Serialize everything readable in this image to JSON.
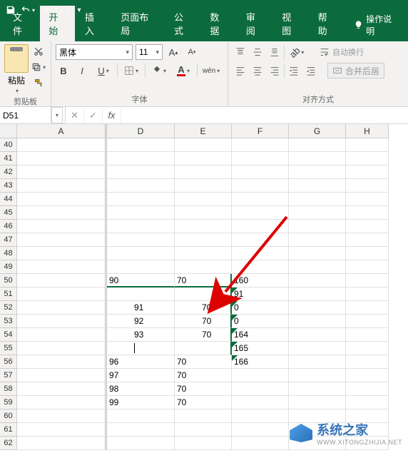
{
  "qat": {
    "save": "save-icon",
    "undo": "undo-icon",
    "redo": "redo-icon",
    "new": "new-icon",
    "print": "print-icon"
  },
  "tabs": {
    "file": "文件",
    "home": "开始",
    "insert": "插入",
    "pagelayout": "页面布局",
    "formulas": "公式",
    "data": "数据",
    "review": "审阅",
    "view": "视图",
    "help": "帮助",
    "tellme": "操作说明"
  },
  "ribbon": {
    "clipboard": {
      "paste": "粘贴",
      "label": "剪贴板"
    },
    "font": {
      "name": "黑体",
      "size": "11",
      "label": "字体",
      "bold": "B",
      "italic": "I",
      "underline": "U",
      "wen": "wén"
    },
    "alignment": {
      "wrap": "自动换行",
      "merge": "合并后居",
      "label": "对齐方式"
    }
  },
  "namebox": "D51",
  "formula": "",
  "columns": [
    "A",
    "D",
    "E",
    "F",
    "G",
    "H"
  ],
  "colWidths": {
    "A": 126,
    "D": 95,
    "E": 80,
    "F": 80,
    "G": 80,
    "H": 60
  },
  "rows": [
    40,
    41,
    42,
    43,
    44,
    45,
    46,
    47,
    48,
    49,
    50,
    51,
    52,
    53,
    54,
    55,
    56,
    57,
    58,
    59,
    60,
    61,
    62
  ],
  "cells": {
    "50": {
      "D": "90",
      "E": "70",
      "F": "160"
    },
    "51": {
      "F": "91"
    },
    "52": {
      "D": "91",
      "E": "70",
      "F": "0"
    },
    "53": {
      "D": "92",
      "E": "70",
      "F": "0"
    },
    "54": {
      "D": "93",
      "E": "70",
      "F": "164"
    },
    "55": {
      "F": "165"
    },
    "56": {
      "D": "96",
      "E": "70",
      "F": "166"
    },
    "57": {
      "D": "97",
      "E": "70"
    },
    "58": {
      "D": "98",
      "E": "70"
    },
    "59": {
      "D": "99",
      "E": "70"
    }
  },
  "indentedRows": [
    52,
    53,
    54
  ],
  "greenTriRows": [
    51,
    52,
    53,
    54,
    55,
    56
  ],
  "watermark": {
    "text": "系统之家",
    "url": "WWW.XITONGZHIJIA.NET"
  }
}
